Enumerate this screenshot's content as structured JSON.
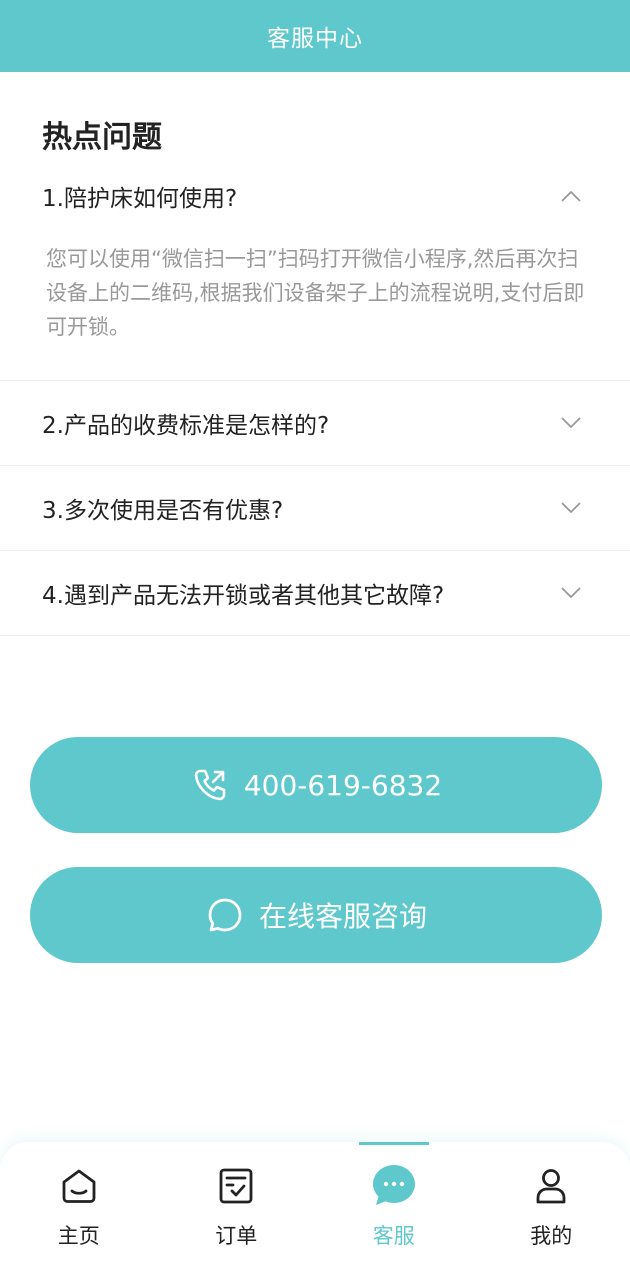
{
  "header": {
    "title": "客服中心"
  },
  "faq": {
    "title": "热点问题",
    "items": [
      {
        "question": "1.陪护床如何使用?",
        "answer": "您可以使用“微信扫一扫”扫码打开微信小程序,然后再次扫设备上的二维码,根据我们设备架子上的流程说明,支付后即可开锁。",
        "expanded": true
      },
      {
        "question": "2.产品的收费标准是怎样的?",
        "expanded": false
      },
      {
        "question": "3.多次使用是否有优惠?",
        "expanded": false
      },
      {
        "question": "4.遇到产品无法开锁或者其他其它故障?",
        "expanded": false
      }
    ]
  },
  "actions": {
    "phone_label": "400-619-6832",
    "chat_label": "在线客服咨询"
  },
  "tabbar": {
    "items": [
      {
        "label": "主页",
        "icon": "home-icon",
        "active": false
      },
      {
        "label": "订单",
        "icon": "order-icon",
        "active": false
      },
      {
        "label": "客服",
        "icon": "chat-bubble-icon",
        "active": true
      },
      {
        "label": "我的",
        "icon": "user-icon",
        "active": false
      }
    ]
  },
  "colors": {
    "accent": "#5fc8cd",
    "text": "#222222",
    "muted": "#999999"
  }
}
